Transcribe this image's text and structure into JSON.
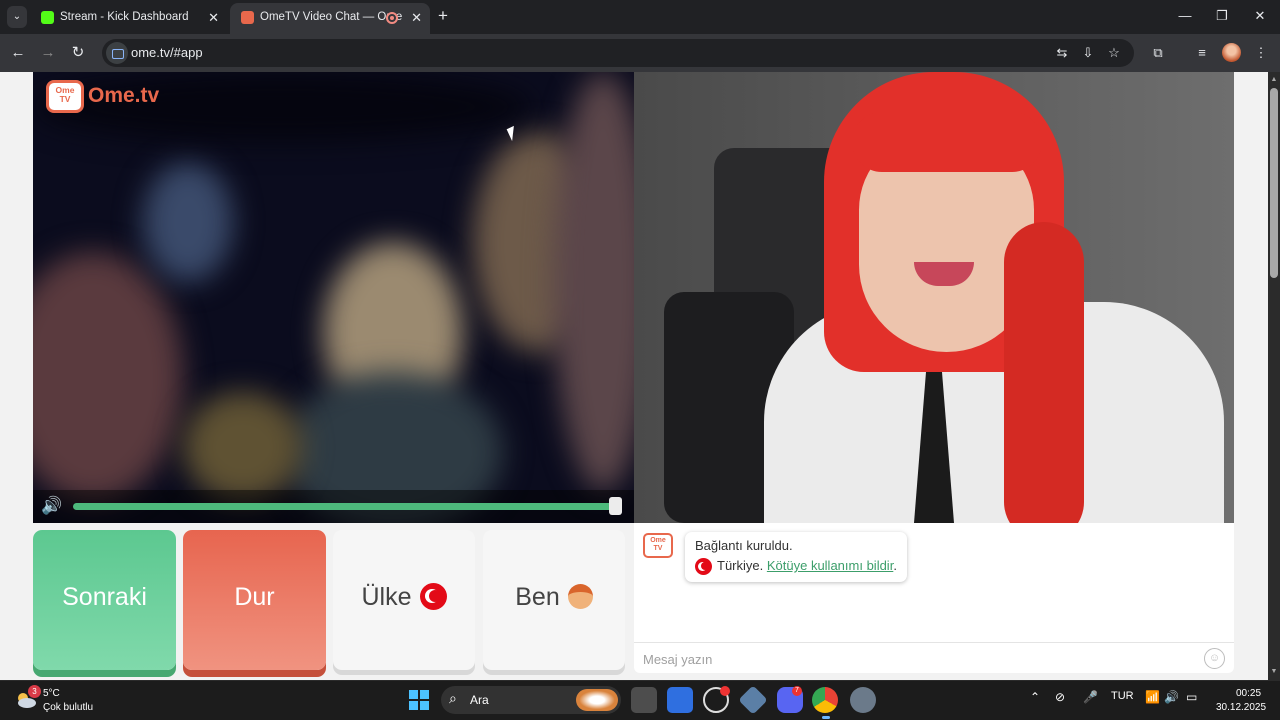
{
  "browser": {
    "tabs": [
      {
        "title": "Stream - Kick Dashboard",
        "favicon_color": "#53fc18"
      },
      {
        "title": "OmeTV Video Chat — Ome",
        "favicon_color": "#e8684c"
      }
    ],
    "url": "ome.tv/#app"
  },
  "site": {
    "logo_badge": "Ome TV",
    "logo_text": "Ome.tv",
    "volume": 1.0,
    "buttons": {
      "next": "Sonraki",
      "stop": "Dur",
      "country": "Ülke",
      "me": "Ben"
    },
    "chat": {
      "logo_badge": "Ome TV",
      "status": "Bağlantı kuruldu.",
      "country_text": "Türkiye.",
      "report_link": "Kötüye kullanımı bildir",
      "report_suffix": ".",
      "input_placeholder": "Mesaj yazın"
    },
    "colors": {
      "brand": "#e8684c",
      "next": "#5cc890",
      "stop": "#e7654f",
      "link": "#3c9e6a"
    }
  },
  "taskbar": {
    "weather_badge": "3",
    "temperature": "5°C",
    "weather_desc": "Çok bulutlu",
    "search_label": "Ara",
    "discord_badge": "7",
    "language": "TUR",
    "time": "00:25",
    "date": "30.12.2025"
  }
}
